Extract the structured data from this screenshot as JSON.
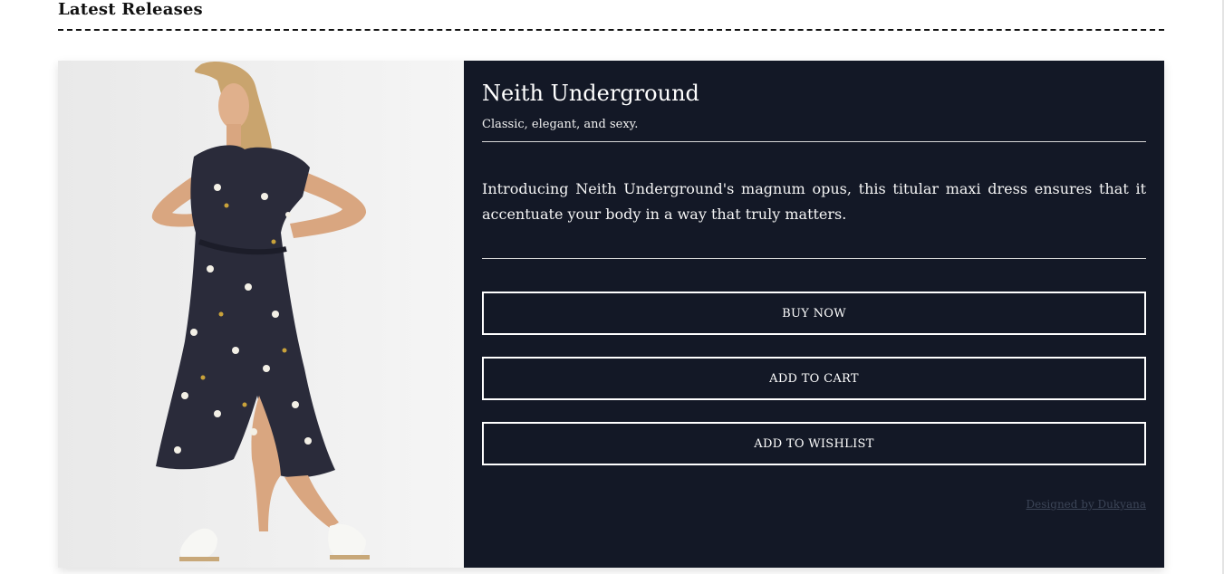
{
  "section": {
    "title": "Latest Releases"
  },
  "product": {
    "name": "Neith Underground",
    "tagline": "Classic, elegant, and sexy.",
    "description": "Introducing Neith Underground's magnum opus, this titular maxi dress ensures that it accentuate your body in a way that truly matters.",
    "image_alt": "Model wearing a dark floral maxi dress and white sneakers"
  },
  "actions": {
    "buy_now": "BUY NOW",
    "add_to_cart": "ADD TO CART",
    "add_to_wishlist": "ADD TO WISHLIST"
  },
  "footer": {
    "credit": "Designed by Dukyana"
  },
  "colors": {
    "card_background": "#131826",
    "page_background": "#ffffff",
    "credit_text": "#3c4557"
  }
}
